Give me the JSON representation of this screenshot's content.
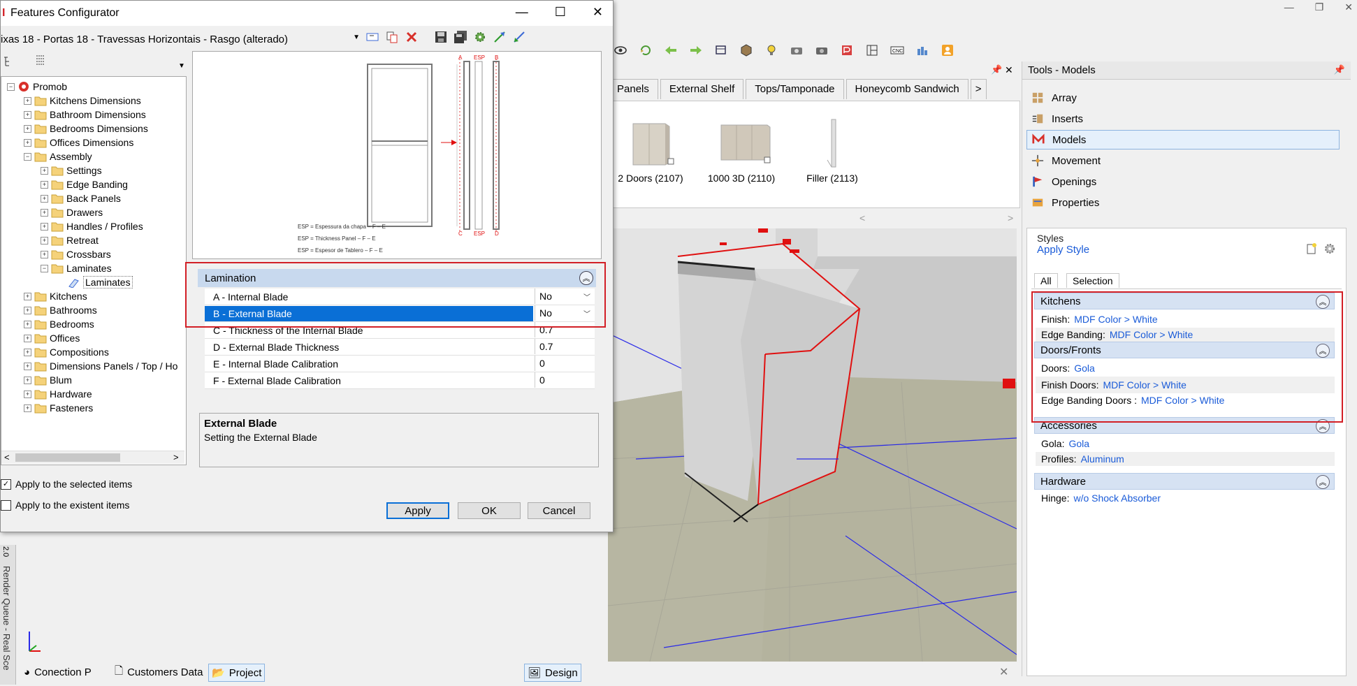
{
  "main": {
    "window_controls": [
      "—",
      "❐",
      "✕"
    ],
    "tabs": [
      "Panels",
      "External Shelf",
      "Tops/Tamponade",
      "Honeycomb Sandwich"
    ],
    "tab_more": ">",
    "panel_pin": "📌",
    "panel_close": "✕",
    "thumbnails": [
      {
        "label": "2 Doors (2107)"
      },
      {
        "label": "1000 3D (2110)"
      },
      {
        "label": "Filler (2113)"
      }
    ],
    "scroll_left": "<",
    "scroll_right": ">",
    "bottom_tabs": [
      "Conection P",
      "Customers Data",
      "Project",
      "Design"
    ],
    "bottom_close": "✕",
    "side_label": "Render Queue - Real Sce",
    "side_label_top": "2.0"
  },
  "tools": {
    "title": "Tools - Models",
    "pin": "📌",
    "items": [
      {
        "label": "Array",
        "icon": "array-icon"
      },
      {
        "label": "Inserts",
        "icon": "inserts-icon"
      },
      {
        "label": "Models",
        "icon": "models-icon",
        "selected": true
      },
      {
        "label": "Movement",
        "icon": "movement-icon"
      },
      {
        "label": "Openings",
        "icon": "openings-icon"
      },
      {
        "label": "Properties",
        "icon": "properties-icon"
      }
    ],
    "styles": {
      "label": "Styles",
      "apply_style": "Apply Style",
      "tabs": [
        "All",
        "Selection"
      ],
      "sections": [
        {
          "title": "Kitchens",
          "props": [
            {
              "name": "Finish:",
              "value": "MDF Color > White"
            },
            {
              "name": "Edge Banding:",
              "value": "MDF Color > White"
            }
          ]
        },
        {
          "title": "Doors/Fronts",
          "props": [
            {
              "name": "Doors:",
              "value": "Gola"
            },
            {
              "name": "Finish Doors:",
              "value": "MDF Color > White"
            },
            {
              "name": "Edge Banding Doors :",
              "value": "MDF Color > White"
            }
          ]
        },
        {
          "title": "Accessories",
          "props": [
            {
              "name": "Gola:",
              "value": "Gola"
            },
            {
              "name": "Profiles:",
              "value": "Aluminum"
            }
          ]
        },
        {
          "title": "Hardware",
          "props": [
            {
              "name": "Hinge:",
              "value": "w/o Shock Absorber"
            }
          ]
        }
      ]
    }
  },
  "dialog": {
    "title": "Features Configurator",
    "controls": [
      "—",
      "☐",
      "✕"
    ],
    "combo_value": "ixas 18 - Portas 18 - Travessas Horizontais - Rasgo (alterado)",
    "tree": [
      {
        "label": "Promob",
        "level": 0,
        "expander": "−",
        "kind": "root"
      },
      {
        "label": "Kitchens Dimensions",
        "level": 1,
        "expander": "+"
      },
      {
        "label": "Bathroom Dimensions",
        "level": 1,
        "expander": "+"
      },
      {
        "label": "Bedrooms Dimensions",
        "level": 1,
        "expander": "+"
      },
      {
        "label": "Offices Dimensions",
        "level": 1,
        "expander": "+"
      },
      {
        "label": "Assembly",
        "level": 1,
        "expander": "−"
      },
      {
        "label": "Settings",
        "level": 2,
        "expander": "+"
      },
      {
        "label": "Edge Banding",
        "level": 2,
        "expander": "+"
      },
      {
        "label": "Back Panels",
        "level": 2,
        "expander": "+"
      },
      {
        "label": "Drawers",
        "level": 2,
        "expander": "+"
      },
      {
        "label": "Handles / Profiles",
        "level": 2,
        "expander": "+"
      },
      {
        "label": "Retreat",
        "level": 2,
        "expander": "+"
      },
      {
        "label": "Crossbars",
        "level": 2,
        "expander": "+"
      },
      {
        "label": "Laminates",
        "level": 2,
        "expander": "−"
      },
      {
        "label": "Laminates",
        "level": 3,
        "expander": "",
        "kind": "leaf",
        "selected": true
      },
      {
        "label": "Kitchens",
        "level": 1,
        "expander": "+"
      },
      {
        "label": "Bathrooms",
        "level": 1,
        "expander": "+"
      },
      {
        "label": "Bedrooms",
        "level": 1,
        "expander": "+"
      },
      {
        "label": "Offices",
        "level": 1,
        "expander": "+"
      },
      {
        "label": "Compositions",
        "level": 1,
        "expander": "+"
      },
      {
        "label": "Dimensions Panels / Top / Ho",
        "level": 1,
        "expander": "+"
      },
      {
        "label": "Blum",
        "level": 1,
        "expander": "+"
      },
      {
        "label": "Hardware",
        "level": 1,
        "expander": "+"
      },
      {
        "label": "Fasteners",
        "level": 1,
        "expander": "+"
      }
    ],
    "preview": {
      "labels_top": [
        "A",
        "ESP",
        "B"
      ],
      "labels_bottom": [
        "C",
        "ESP",
        "D"
      ],
      "legend": [
        "ESP = Espessura da chapa – F – E",
        "ESP = Thickness Panel – F – E",
        "ESP = Espesor de Tablero – F – E"
      ]
    },
    "lamination": {
      "title": "Lamination",
      "rows": [
        {
          "name": "A -  Internal Blade",
          "value": "No",
          "dropdown": true
        },
        {
          "name": "B - External Blade",
          "value": "No",
          "dropdown": true,
          "selected": true
        },
        {
          "name": "C -  Thickness of the Internal Blade",
          "value": "0.7"
        },
        {
          "name": "D - External Blade Thickness",
          "value": "0.7"
        },
        {
          "name": "E -  Internal Blade Calibration",
          "value": "0"
        },
        {
          "name": "F - External Blade Calibration",
          "value": "0"
        }
      ]
    },
    "description": {
      "title": "External Blade",
      "text": "Setting the External Blade"
    },
    "checkboxes": [
      {
        "label": "Apply to the selected items",
        "checked": true
      },
      {
        "label": "Apply to the existent items",
        "checked": false
      }
    ],
    "buttons": {
      "apply": "Apply",
      "ok": "OK",
      "cancel": "Cancel"
    },
    "tree_scroll_left": "<",
    "tree_scroll_right": ">"
  },
  "colors": {
    "highlight": "#d21f26",
    "selection": "#0a6fd6",
    "link": "#1a5bd8",
    "section_header": "#d6e2f3"
  }
}
